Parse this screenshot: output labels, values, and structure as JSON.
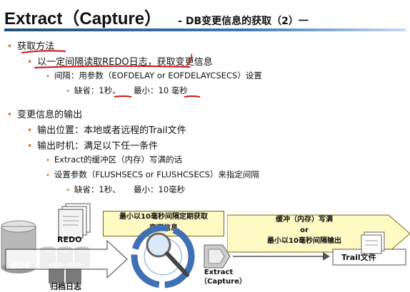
{
  "title": {
    "main": "Extract（Capture）",
    "sub": "- DB变更信息的获取（2）一"
  },
  "bullets": {
    "b1": "获取方法",
    "b1_1": "以一定间隔读取REDO日志，获取变更信息",
    "b1_1_1": "间隔：用参数（EOFDELAY  or EOFDELAYCSECS）设置",
    "b1_1_1_1": {
      "a": "缺省：",
      "b": "1秒",
      "c": "、     最小：",
      "d": "10",
      "e": " 毫秒"
    },
    "b2": "变更信息的输出",
    "b2_1": "输出位置：本地或者远程的Trail文件",
    "b2_2": "输出时机：满足以下任一条件",
    "b2_2_1": "Extract的缓冲区（内存）写满的话",
    "b2_2_2": "设置参数（FLUSHSECS or FLUSHCSECS）来指定间隔",
    "b2_2_2_1": "缺省：1秒、     最小：10毫秒"
  },
  "diagram": {
    "note_left": [
      "最小以10毫秒间隔定期获取",
      "变更信息"
    ],
    "note_right": [
      "缓冲（内存）写满",
      "or",
      "最小以10毫秒间隔输出"
    ],
    "redo": "REDO",
    "source_db": "源DB",
    "archive_log": "归档日志",
    "extract": [
      "Extract",
      "（Capture）"
    ],
    "trail_file": "Trail文件"
  },
  "colors": {
    "bullet": "#d0702a",
    "pen_red": "#cc1111",
    "note_fill": "#fff9c4",
    "capture_blue": "#3f6fb5"
  }
}
